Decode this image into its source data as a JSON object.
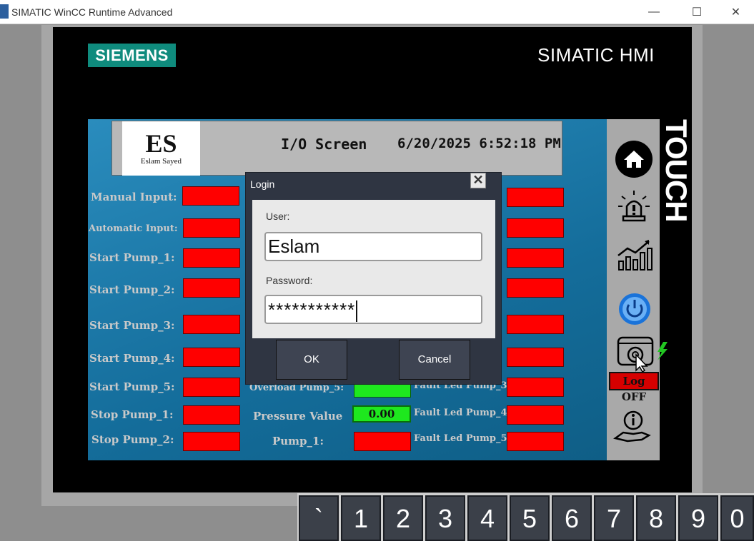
{
  "window": {
    "title": "SIMATIC WinCC Runtime Advanced",
    "minimize": "—",
    "maximize": "☐",
    "close": "✕"
  },
  "panel": {
    "brand": "SIEMENS",
    "model": "SIMATIC HMI",
    "touch_label": "TOUCH"
  },
  "header": {
    "logo_big": "ES",
    "logo_small": "Eslam Sayed",
    "screen_title": "I/O Screen",
    "datetime": "6/20/2025 6:52:18 PM"
  },
  "left_labels": [
    "Manual Input:",
    "Automatic Input:",
    "Start Pump_1:",
    "Start Pump_2:",
    "Start Pump_3:",
    "Start Pump_4:",
    "Start Pump_5:",
    "Stop Pump_1:",
    "Stop Pump_2:"
  ],
  "middle": {
    "overload_label": "Overload Pump_5:",
    "pressure_label": "Pressure Value",
    "pressure_value": "0.00",
    "pump1_label": "Pump_1:"
  },
  "right_labels": {
    "fault3": "Fault Led Pump_3:",
    "fault4": "Fault Led Pump_4:",
    "fault5": "Fault Led Pump_5:"
  },
  "sidebar": {
    "icons": [
      "home-icon",
      "alarm-icon",
      "trend-icon",
      "power-icon",
      "settings-icon",
      "info-icon"
    ],
    "logoff_label": "Log OFF"
  },
  "login": {
    "title": "Login",
    "user_label": "User:",
    "user_value": "Eslam",
    "password_label": "Password:",
    "password_value": "***********",
    "ok_label": "OK",
    "cancel_label": "Cancel"
  },
  "keyboard": {
    "keys": [
      "`",
      "1",
      "2",
      "3",
      "4",
      "5",
      "6",
      "7",
      "8",
      "9",
      "0"
    ]
  },
  "colors": {
    "led_off": "#ff0000",
    "led_on": "#1ee81e",
    "siemens_teal": "#0f8b7d",
    "screen_blue": "#1a7cae"
  }
}
